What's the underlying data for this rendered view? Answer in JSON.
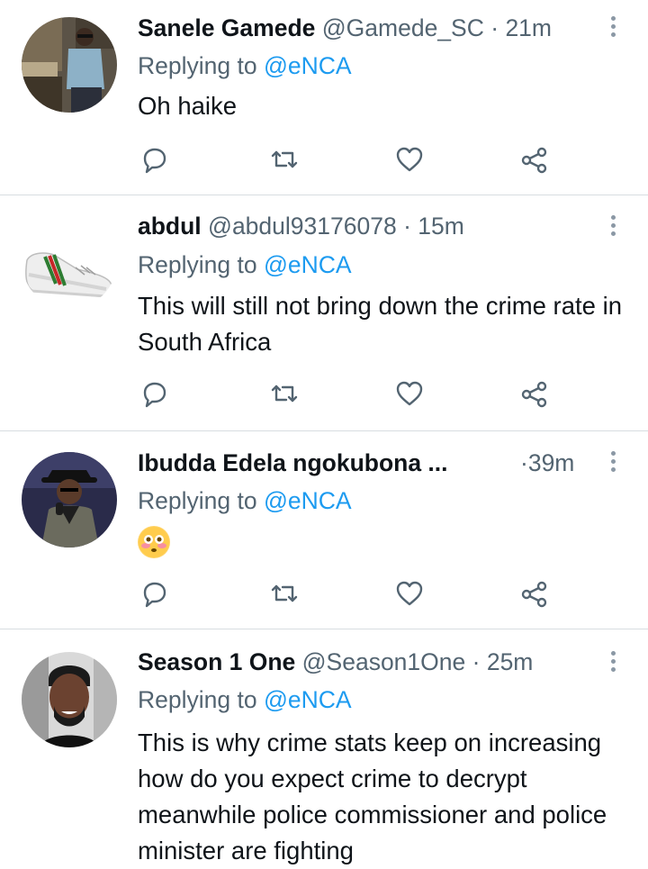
{
  "tweets": [
    {
      "name": "Sanele Gamede",
      "handle": "@Gamede_SC",
      "sep": "·",
      "time": "21m",
      "replying_prefix": "Replying to",
      "mention": "@eNCA",
      "text": "Oh haike",
      "avatar": "man-sunglasses-photo"
    },
    {
      "name": "abdul",
      "handle": "@abdul93176078",
      "sep": "·",
      "time": "15m",
      "replying_prefix": "Replying to",
      "mention": "@eNCA",
      "text": "This will still not bring down the crime rate in South Africa",
      "avatar": "sneaker-photo"
    },
    {
      "name": "Ibudda Edela ngokubona ...",
      "handle": "",
      "sep": "·",
      "time": "39m",
      "replying_prefix": "Replying to",
      "mention": "@eNCA",
      "text": "",
      "emoji": "flushed-face",
      "avatar": "man-with-hat-microphone-photo"
    },
    {
      "name": "Season 1 One",
      "handle": "@Season1One",
      "sep": "·",
      "time": "25m",
      "replying_prefix": "Replying to",
      "mention": "@eNCA",
      "text": "This is why crime stats keep on increasing how do you expect crime to decrypt meanwhile police commissioner and police minister are fighting",
      "avatar": "smiling-man-photo"
    }
  ],
  "actions": [
    "reply-icon",
    "retweet-icon",
    "like-icon",
    "share-icon"
  ],
  "colors": {
    "link": "#1d9bf0",
    "muted": "#536471",
    "text": "#0f1419",
    "divider": "#d8dde1"
  }
}
